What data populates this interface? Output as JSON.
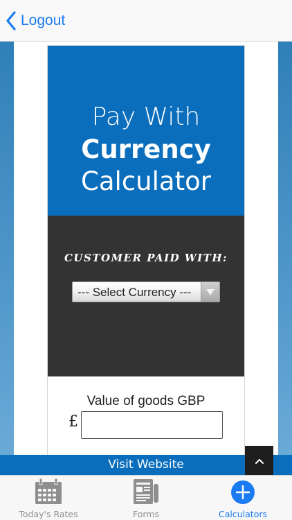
{
  "nav": {
    "back_label": "Logout"
  },
  "calculator": {
    "hero": {
      "line1": "Pay With",
      "line2": "Currency",
      "line3": "Calculator"
    },
    "paid_with_label": "CUSTOMER PAID WITH:",
    "currency_select": {
      "selected": "--- Select Currency ---"
    },
    "goods": {
      "label": "Value of goods GBP",
      "currency_symbol": "£",
      "value": ""
    }
  },
  "visit_bar": {
    "label": "Visit Website"
  },
  "tabs": [
    {
      "label": "Today's Rates",
      "icon": "calendar-icon",
      "active": false
    },
    {
      "label": "Forms",
      "icon": "forms-icon",
      "active": false
    },
    {
      "label": "Calculators",
      "icon": "plus-circle-icon",
      "active": true
    }
  ],
  "colors": {
    "accent": "#1a7bf2",
    "brand_blue": "#0a6ebd",
    "dark_panel": "#333333"
  }
}
